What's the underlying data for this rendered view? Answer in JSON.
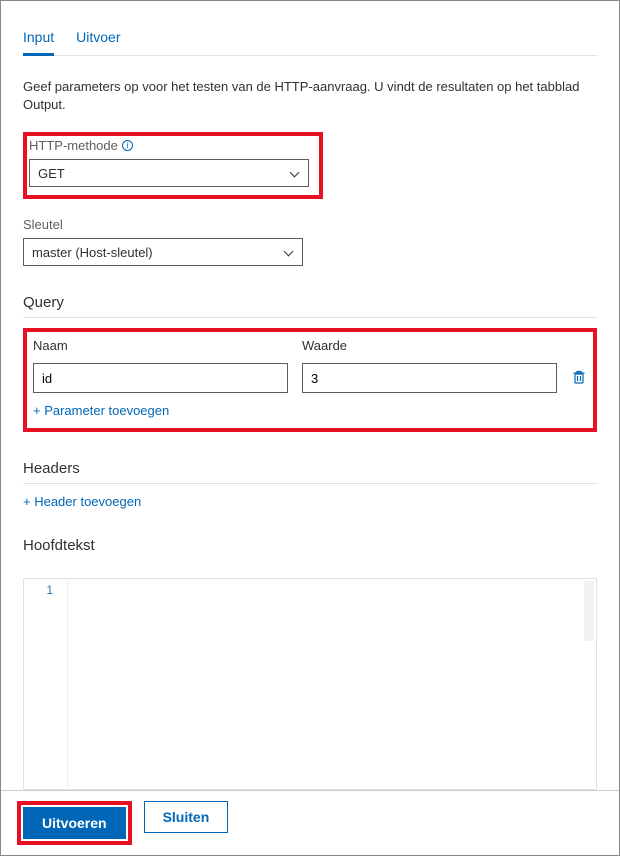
{
  "tabs": {
    "input": "Input",
    "output": "Uitvoer"
  },
  "description": "Geef parameters op voor het testen van de HTTP-aanvraag. U vindt de resultaten op het tabblad Output.",
  "http_method": {
    "label": "HTTP-methode",
    "value": "GET"
  },
  "key": {
    "label": "Sleutel",
    "value": "master (Host-sleutel)"
  },
  "query": {
    "title": "Query",
    "name_header": "Naam",
    "value_header": "Waarde",
    "rows": [
      {
        "name": "id",
        "value": "3"
      }
    ],
    "add_label": "+ Parameter toevoegen"
  },
  "headers": {
    "title": "Headers",
    "add_label": "+ Header toevoegen"
  },
  "body": {
    "title": "Hoofdtekst",
    "line_number": "1"
  },
  "footer": {
    "run": "Uitvoeren",
    "close": "Sluiten"
  }
}
